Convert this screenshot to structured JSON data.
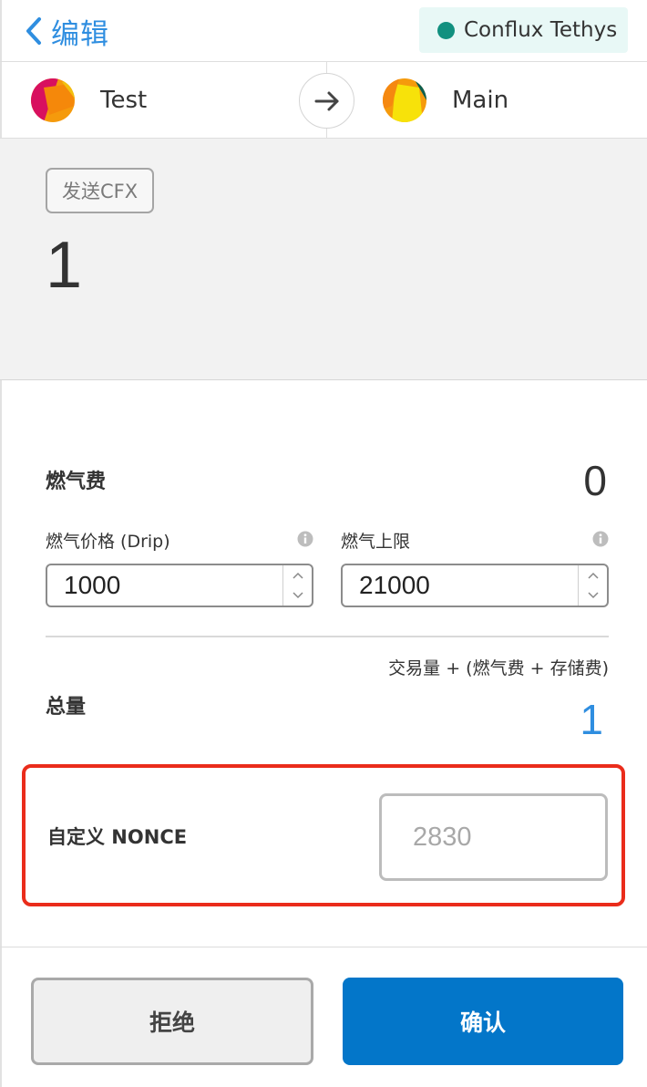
{
  "header": {
    "back_label": "编辑",
    "network": {
      "name": "Conflux Tethys",
      "dot_color": "#11907f"
    }
  },
  "accounts": {
    "from": {
      "name": "Test",
      "avatar_icon": "jazzicon"
    },
    "to": {
      "name": "Main",
      "avatar_icon": "jazzicon"
    },
    "arrow_icon": "arrow-right-icon"
  },
  "summary": {
    "action_badge": "发送CFX",
    "amount": "1"
  },
  "gas": {
    "fee_label": "燃气费",
    "fee_value": "0",
    "price_label": "燃气价格 (Drip)",
    "price_value": "1000",
    "limit_label": "燃气上限",
    "limit_value": "21000"
  },
  "total": {
    "formula": "交易量 + (燃气费 + 存储费)",
    "label": "总量",
    "value": "1"
  },
  "nonce": {
    "label": "自定义 NONCE",
    "placeholder": "2830"
  },
  "buttons": {
    "reject": "拒绝",
    "confirm": "确认"
  },
  "colors": {
    "accent": "#2f8ee0",
    "confirm_button": "#0376c9",
    "highlight": "#ea2c1b"
  }
}
